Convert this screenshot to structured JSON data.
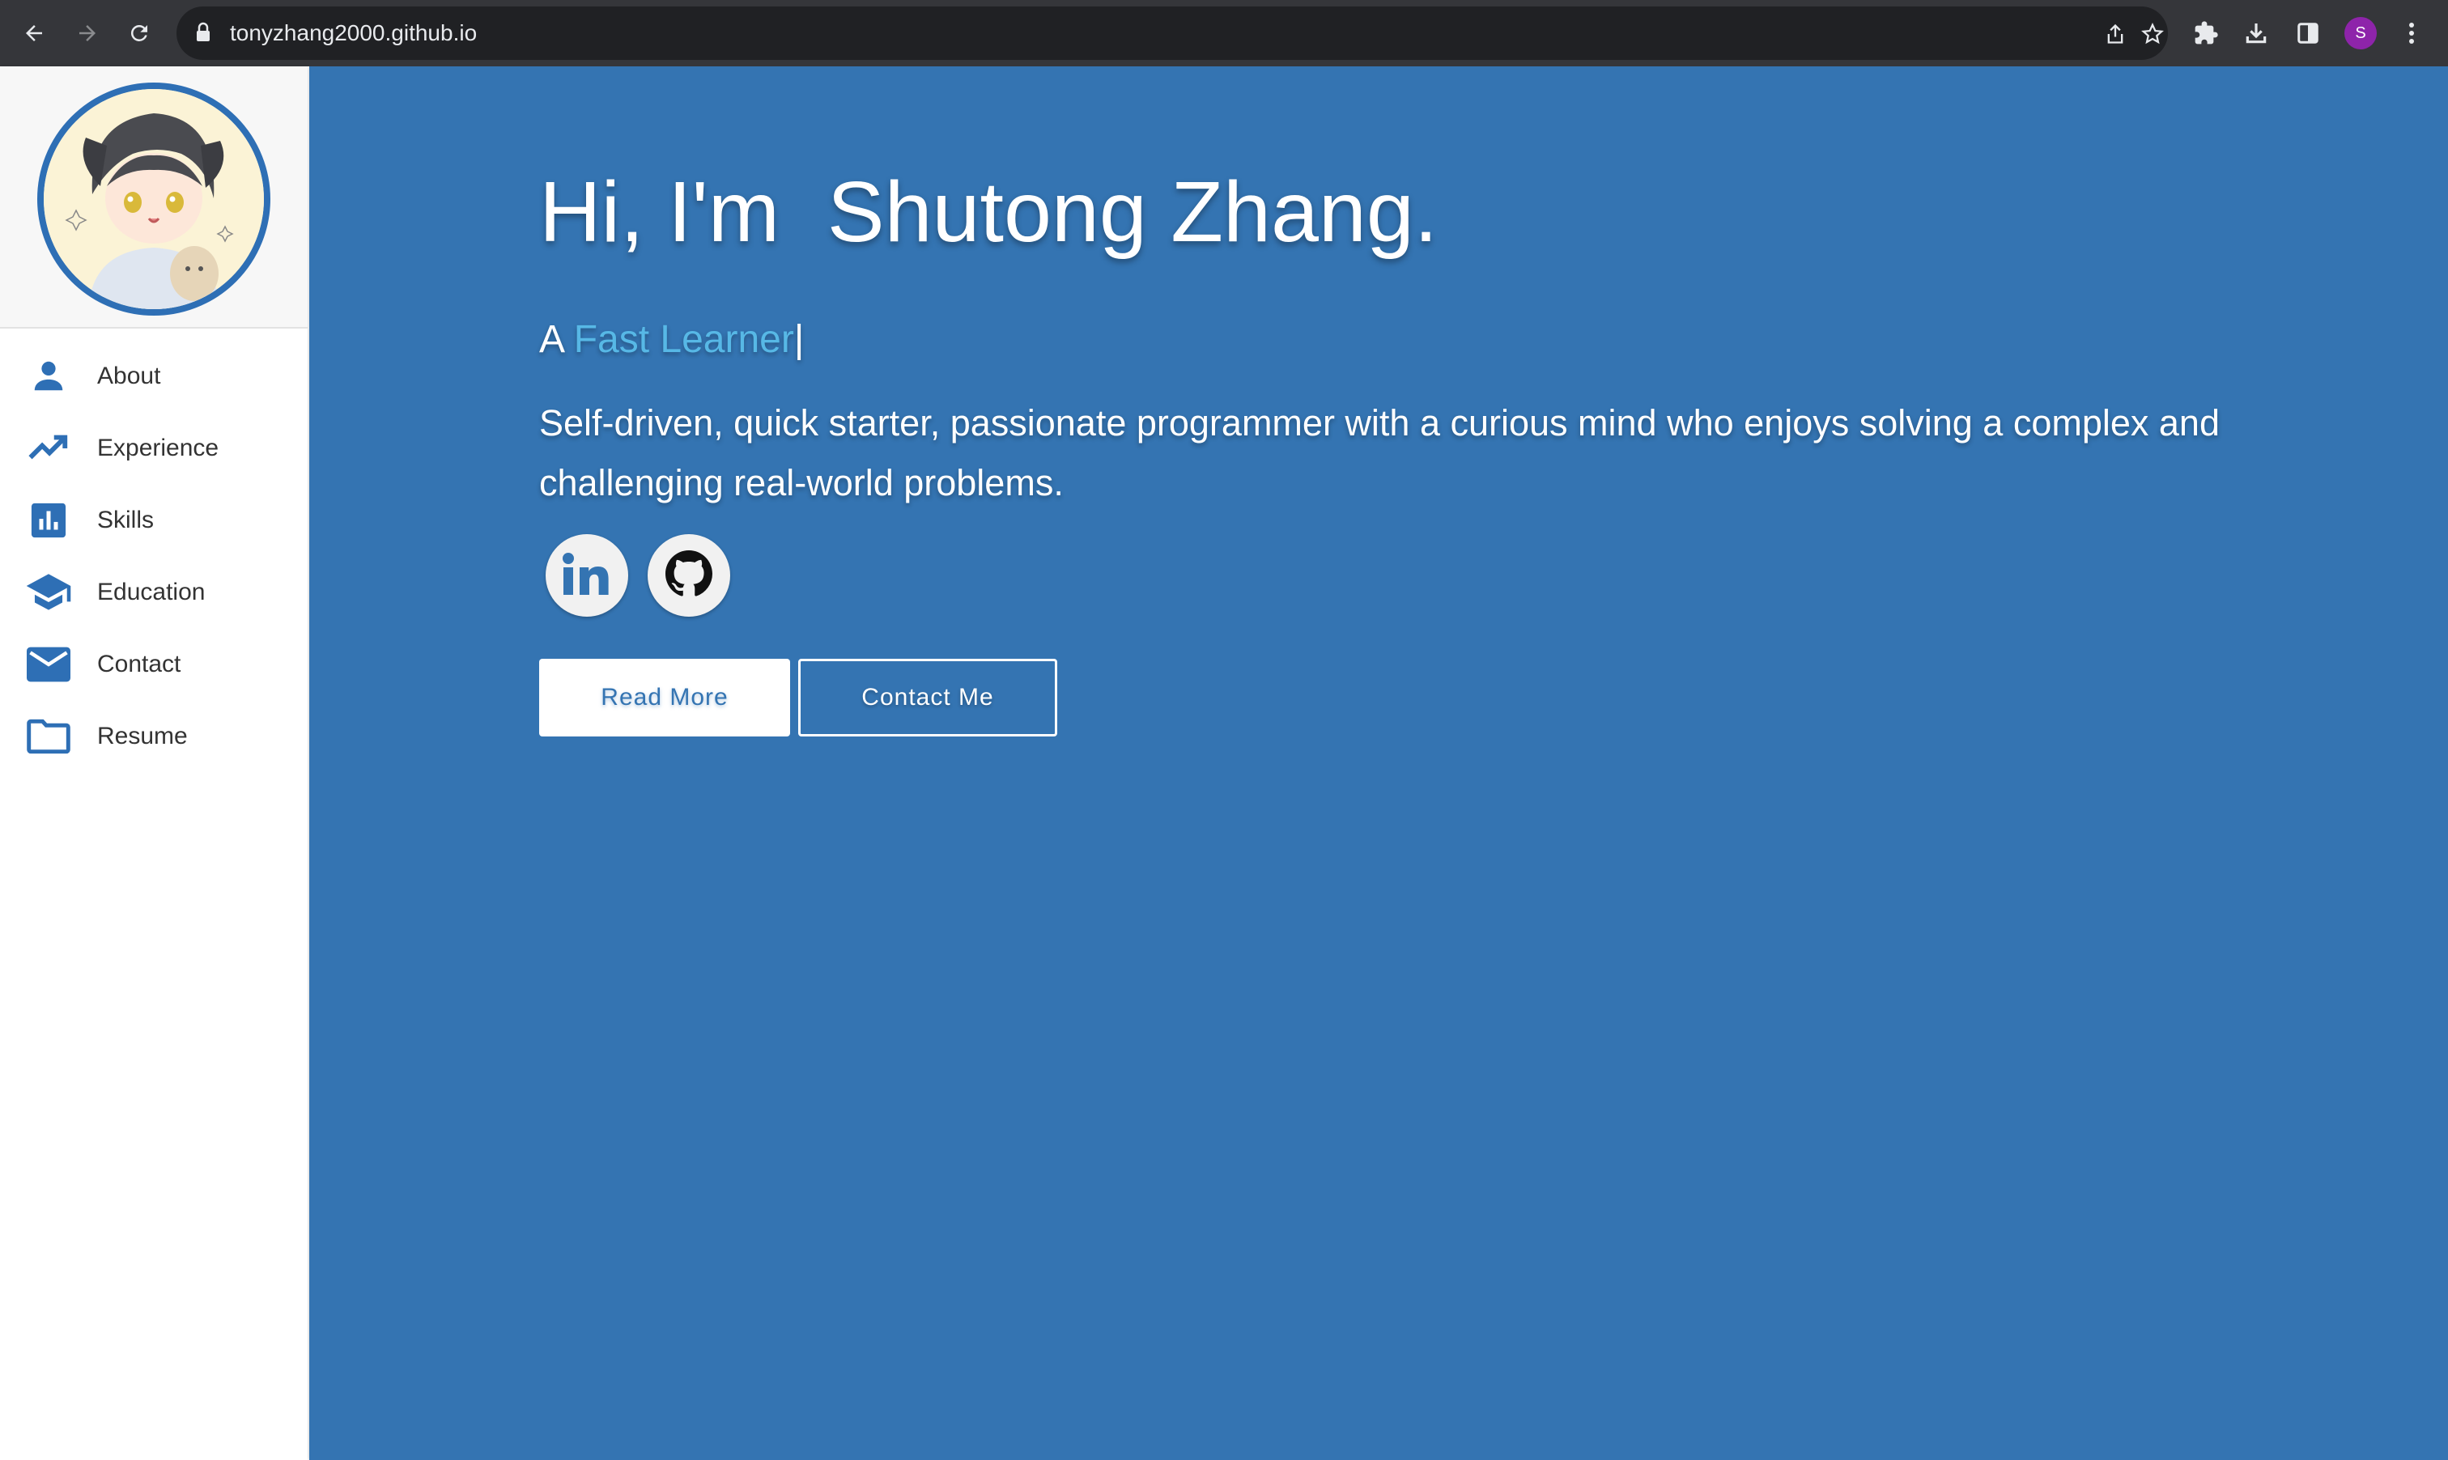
{
  "browser": {
    "url": "tonyzhang2000.github.io",
    "profile_initial": "S",
    "icons": [
      "back-arrow-icon",
      "forward-arrow-icon",
      "reload-icon",
      "lock-icon",
      "share-icon",
      "star-icon",
      "extensions-puzzle-icon",
      "download-icon",
      "side-panel-icon",
      "kebab-menu-icon"
    ]
  },
  "sidebar": {
    "items": [
      {
        "label": "About",
        "icon": "person-icon"
      },
      {
        "label": "Experience",
        "icon": "trending-up-icon"
      },
      {
        "label": "Skills",
        "icon": "bar-chart-icon"
      },
      {
        "label": "Education",
        "icon": "graduation-cap-icon"
      },
      {
        "label": "Contact",
        "icon": "envelope-icon"
      },
      {
        "label": "Resume",
        "icon": "folder-icon"
      }
    ]
  },
  "hero": {
    "title": "Hi, I'm  Shutong Zhang.",
    "subtitle_prefix": "A ",
    "subtitle_highlight": "Fast Learner",
    "subtitle_cursor": "|",
    "description": "Self-driven, quick starter, passionate programmer with a curious mind who enjoys solving a complex and challenging real-world problems.",
    "social": [
      {
        "name": "linkedin",
        "icon": "linkedin-icon"
      },
      {
        "name": "github",
        "icon": "github-icon"
      }
    ],
    "read_more_label": "Read More",
    "contact_me_label": "Contact Me"
  },
  "colors": {
    "accent": "#3474b2",
    "highlight": "#57b8e6",
    "chrome_bg": "#35363a",
    "omnibox_bg": "#202124"
  }
}
